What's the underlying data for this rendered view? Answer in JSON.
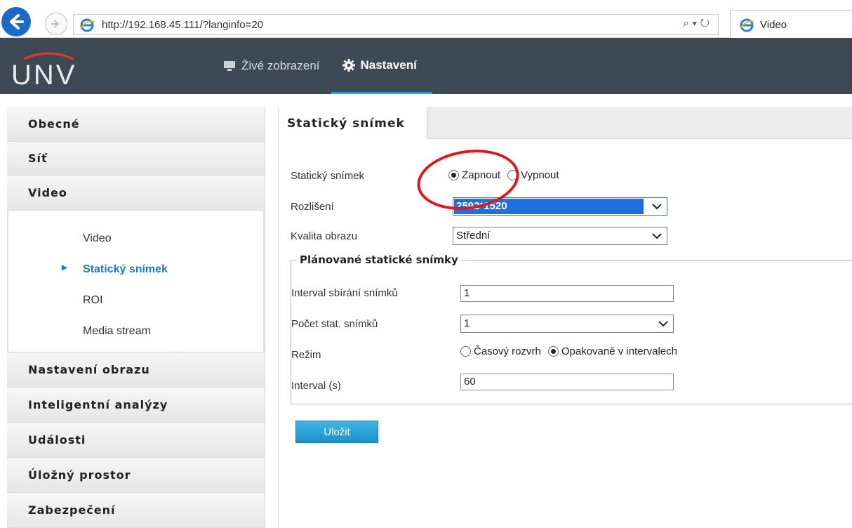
{
  "browser": {
    "url": "http://192.168.45.111/?langinfo=20",
    "search_symbol": "⌕ ▾ ↻",
    "tab_title": "Video"
  },
  "app": {
    "logo": "UNV",
    "topnav": [
      {
        "label": "Živé zobrazení"
      },
      {
        "label": "Nastavení"
      }
    ]
  },
  "sidebar": {
    "items": [
      {
        "label": "Obecné"
      },
      {
        "label": "Síť"
      },
      {
        "label": "Video"
      }
    ],
    "sub_items": [
      {
        "label": "Video"
      },
      {
        "label": "Statický snímek"
      },
      {
        "label": "ROI"
      },
      {
        "label": "Media stream"
      }
    ],
    "items_after": [
      {
        "label": "Nastavení obrazu"
      },
      {
        "label": "Inteligentní analýzy"
      },
      {
        "label": "Události"
      },
      {
        "label": "Úložný prostor"
      },
      {
        "label": "Zabezpečení"
      }
    ]
  },
  "content": {
    "tab_label": "Statický snímek",
    "snapshot": {
      "label": "Statický snímek",
      "on": "Zapnout",
      "off": "Vypnout",
      "selected": "on"
    },
    "resolution": {
      "label": "Rozlišení",
      "value": "2592*1520"
    },
    "quality": {
      "label": "Kvalita obrazu",
      "value": "Střední"
    },
    "scheduled": {
      "legend": "Plánované statické snímky",
      "interval_collect": {
        "label": "Interval sbírání snímků",
        "value": "1"
      },
      "count": {
        "label": "Počet stat. snímků",
        "value": "1"
      },
      "mode": {
        "label": "Režim",
        "schedule": "Časový rozvrh",
        "repeat": "Opakovaně v intervalech",
        "selected": "repeat"
      },
      "interval_s": {
        "label": "Interval (s)",
        "value": "60"
      }
    },
    "save_label": "Uložit"
  },
  "colors": {
    "header_bg": "#3d4a56",
    "active_underline": "#2ea2d8",
    "link_blue": "#1b7ac0",
    "annotation_red": "#e0161c"
  }
}
